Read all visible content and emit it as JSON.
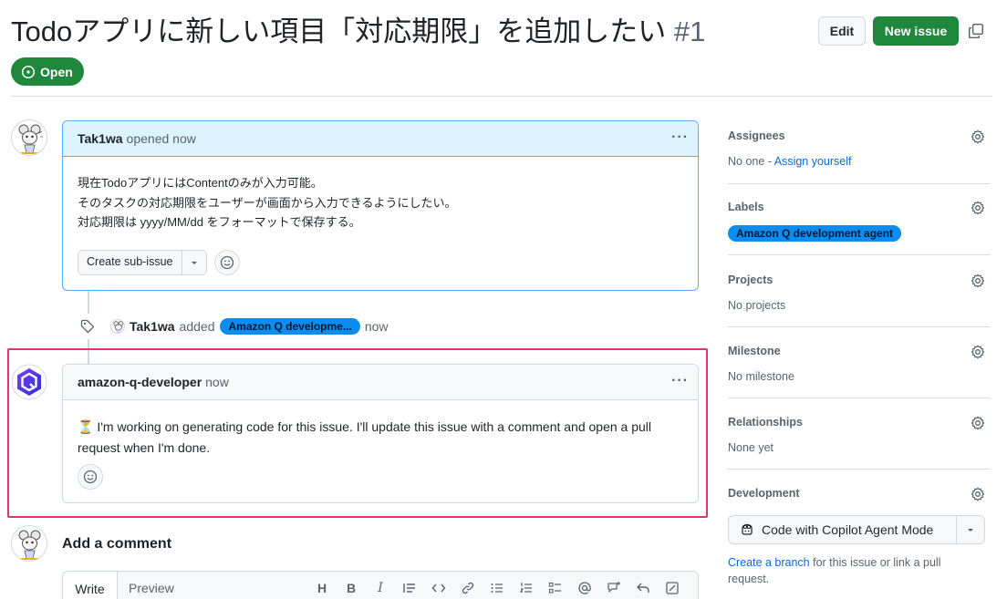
{
  "issue": {
    "title": "Todoアプリに新しい項目「対応期限」を追加したい",
    "number": "#1",
    "state": "Open",
    "edit_label": "Edit",
    "new_issue_label": "New issue"
  },
  "comments": [
    {
      "author": "Tak1wa",
      "meta": "opened now",
      "body_lines": [
        "現在TodoアプリにはContentのみが入力可能。",
        "そのタスクの対応期限をユーザーが画面から入力できるようにしたい。",
        "対応期限は yyyy/MM/dd をフォーマットで保存する。"
      ],
      "sub_issue_label": "Create sub-issue"
    },
    {
      "author": "amazon-q-developer",
      "meta": "now",
      "hourglass": "⏳",
      "body": "I'm working on generating code for this issue. I'll update this issue with a comment and open a pull request when I'm done."
    }
  ],
  "event": {
    "actor": "Tak1wa",
    "action": "added",
    "label": "Amazon Q developme...",
    "time": "now"
  },
  "add_comment": {
    "title": "Add a comment",
    "tab_write": "Write",
    "tab_preview": "Preview",
    "tools": [
      "H",
      "B",
      "I"
    ]
  },
  "sidebar": {
    "assignees_title": "Assignees",
    "assignees_none": "No one - ",
    "assign_yourself": "Assign yourself",
    "labels_title": "Labels",
    "label_name": "Amazon Q development agent",
    "projects_title": "Projects",
    "projects_value": "No projects",
    "milestone_title": "Milestone",
    "milestone_value": "No milestone",
    "relationships_title": "Relationships",
    "relationships_value": "None yet",
    "development_title": "Development",
    "copilot_label": "Code with Copilot Agent Mode",
    "create_branch": "Create a branch",
    "dev_text": " for this issue or link a pull request."
  },
  "colors": {
    "open_green": "#1f883d",
    "label_blue": "#0a8cf0",
    "highlight_pink": "#e8306f",
    "link_blue": "#0969da"
  }
}
